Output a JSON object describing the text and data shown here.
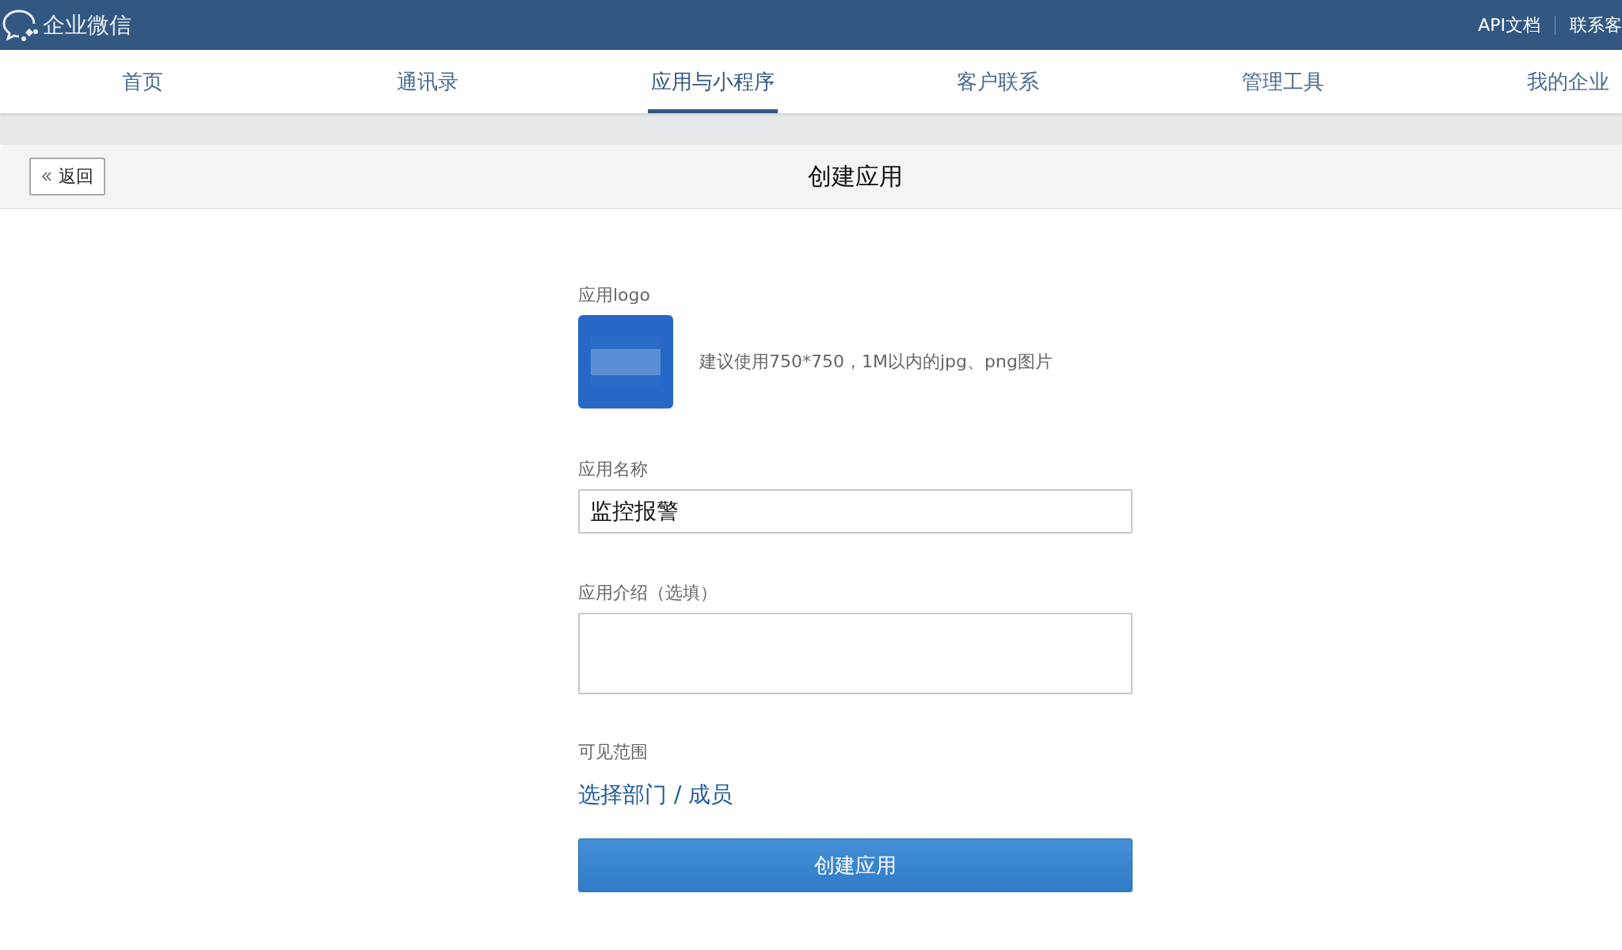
{
  "header": {
    "brand": "企业微信",
    "links": [
      "API文档",
      "联系客"
    ]
  },
  "tabs": [
    {
      "label": "首页",
      "selected": false
    },
    {
      "label": "通讯录",
      "selected": false
    },
    {
      "label": "应用与小程序",
      "selected": true
    },
    {
      "label": "客户联系",
      "selected": false
    },
    {
      "label": "管理工具",
      "selected": false
    },
    {
      "label": "我的企业",
      "selected": false
    }
  ],
  "page": {
    "back_button": "返回",
    "title": "创建应用"
  },
  "form": {
    "logo_label": "应用logo",
    "logo_hint": "建议使用750*750，1M以内的jpg、png图片",
    "name_label": "应用名称",
    "name_value": "监控报警",
    "intro_label": "应用介绍（选填）",
    "scope_label": "可见范围",
    "scope_link": "选择部门 / 成员",
    "submit": "创建应用"
  }
}
